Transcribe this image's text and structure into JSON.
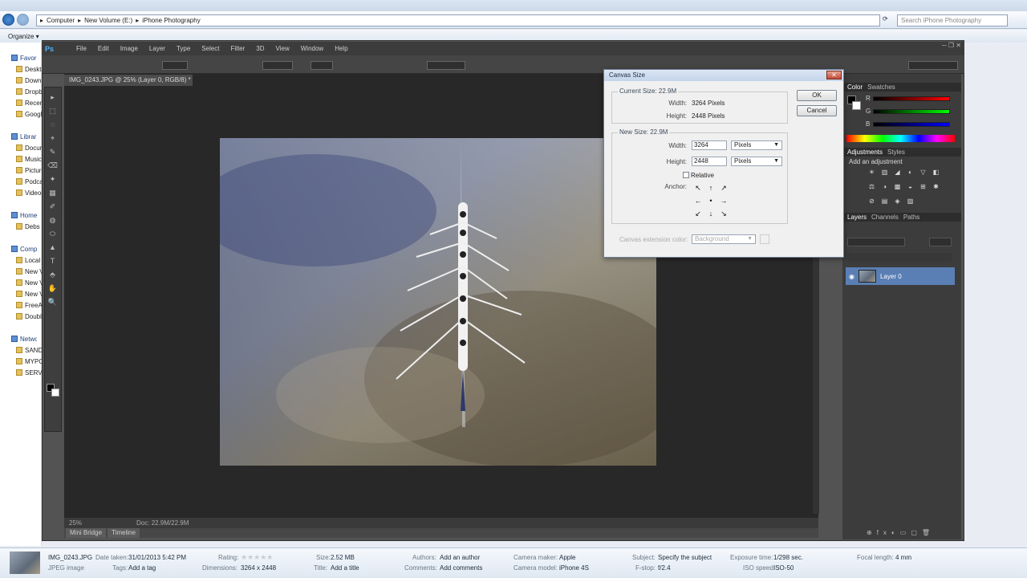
{
  "explorer": {
    "breadcrumb": [
      "Computer",
      "New Volume (E:)",
      "iPhone Photography"
    ],
    "search_placeholder": "Search iPhone Photography",
    "command_bar": [
      "Organize ▾"
    ],
    "nav": [
      {
        "label": "Favorites",
        "header": true
      },
      {
        "label": "Desktop"
      },
      {
        "label": "Downloads"
      },
      {
        "label": "Dropbox"
      },
      {
        "label": "Recent Places"
      },
      {
        "label": "Google Drive"
      },
      {
        "label": "Libraries",
        "header": true
      },
      {
        "label": "Documents"
      },
      {
        "label": "Music"
      },
      {
        "label": "Pictures"
      },
      {
        "label": "Podcasts"
      },
      {
        "label": "Videos"
      },
      {
        "label": "Homegroup",
        "header": true
      },
      {
        "label": "Debs"
      },
      {
        "label": "Computer",
        "header": true
      },
      {
        "label": "Local Disk (C:)"
      },
      {
        "label": "New Volume (E:)"
      },
      {
        "label": "New Volume"
      },
      {
        "label": "New Volume"
      },
      {
        "label": "FreeAgent"
      },
      {
        "label": "DoubleDisk"
      },
      {
        "label": "Network",
        "header": true
      },
      {
        "label": "SANDBOX"
      },
      {
        "label": "MYPC"
      },
      {
        "label": "SERVER"
      }
    ]
  },
  "details": {
    "filename": "IMG_0243.JPG",
    "filetype": "JPEG image",
    "date_taken_label": "Date taken:",
    "date_taken": "31/01/2013 5:42 PM",
    "tags_label": "Tags:",
    "tags": "Add a tag",
    "rating_label": "Rating:",
    "dimensions_label": "Dimensions:",
    "dimensions": "3264 x 2448",
    "size_label": "Size:",
    "size": "2.52 MB",
    "title_label": "Title:",
    "title": "Add a title",
    "authors_label": "Authors:",
    "authors": "Add an author",
    "comments_label": "Comments:",
    "comments": "Add comments",
    "camera_maker_label": "Camera maker:",
    "camera_maker": "Apple",
    "camera_model_label": "Camera model:",
    "camera_model": "iPhone 4S",
    "subject_label": "Subject:",
    "subject": "Specify the subject",
    "fstop_label": "F-stop:",
    "fstop": "f/2.4",
    "exposure_label": "Exposure time:",
    "exposure": "1/298 sec.",
    "iso_label": "ISO speed:",
    "iso": "ISO-50",
    "focal_label": "Focal length:",
    "focal": "4 mm"
  },
  "photoshop": {
    "logo": "Ps",
    "menu": [
      "File",
      "Edit",
      "Image",
      "Layer",
      "Type",
      "Select",
      "Filter",
      "3D",
      "View",
      "Window",
      "Help"
    ],
    "doc_tab": "IMG_0243.JPG @ 25% (Layer 0, RGB/8) *",
    "zoom": "25%",
    "doc_info": "Doc: 22.9M/22.9M",
    "mini_tabs": [
      "Mini Bridge",
      "Timeline"
    ],
    "panels": {
      "color_tabs": [
        "Color",
        "Swatches"
      ],
      "channels": [
        "R",
        "G",
        "B"
      ],
      "adjust_tabs": [
        "Adjustments",
        "Styles"
      ],
      "adjust_title": "Add an adjustment",
      "layers_tabs": [
        "Layers",
        "Channels",
        "Paths"
      ],
      "layer_name": "Layer 0"
    }
  },
  "dialog": {
    "title": "Canvas Size",
    "current_size_label": "Current Size: 22.9M",
    "current_width_label": "Width:",
    "current_width": "3264 Pixels",
    "current_height_label": "Height:",
    "current_height": "2448 Pixels",
    "new_size_label": "New Size: 22.9M",
    "width_label": "Width:",
    "width_value": "3264",
    "width_unit": "Pixels",
    "height_label": "Height:",
    "height_value": "2448",
    "height_unit": "Pixels",
    "relative_label": "Relative",
    "anchor_label": "Anchor:",
    "anchor_arrows": [
      "↖",
      "↑",
      "↗",
      "←",
      "•",
      "→",
      "↙",
      "↓",
      "↘"
    ],
    "extension_label": "Canvas extension color:",
    "extension_value": "Background",
    "ok_label": "OK",
    "cancel_label": "Cancel"
  },
  "colors": {
    "ps_bg": "#535353",
    "ps_dark": "#282828",
    "layer_selected": "#5a7fb4",
    "dialog_bg": "#f0f0f0"
  }
}
